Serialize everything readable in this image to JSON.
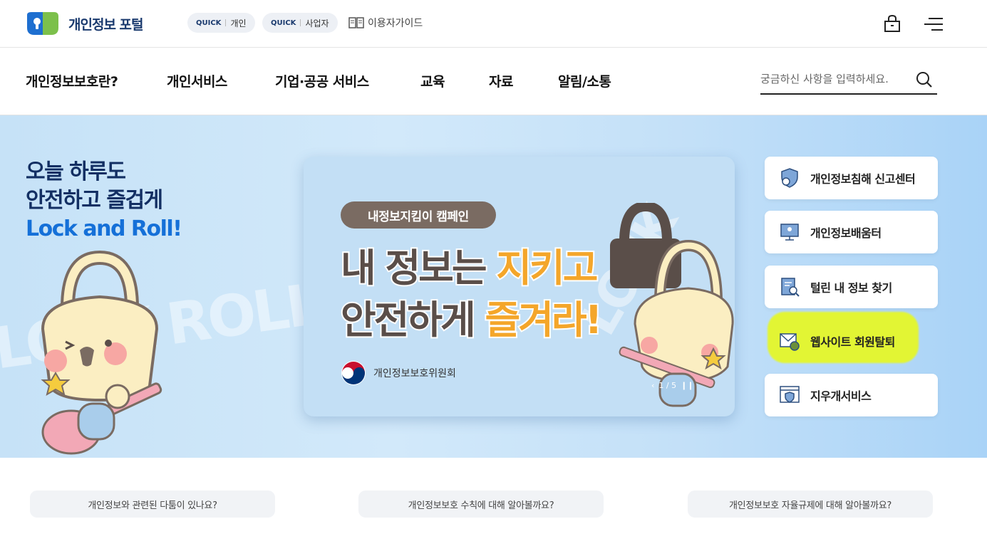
{
  "header": {
    "logo_text": "개인정보 포털",
    "quick_personal": {
      "tag": "QUICK",
      "label": "개인"
    },
    "quick_business": {
      "tag": "QUICK",
      "label": "사업자"
    },
    "guide_label": "이용자가이드",
    "icons": [
      "lock-icon",
      "menu-icon"
    ]
  },
  "nav": {
    "items": [
      "개인정보보호란?",
      "개인서비스",
      "기업·공공 서비스",
      "교육",
      "자료",
      "알림/소통"
    ],
    "search_placeholder": "궁금하신 사항을 입력하세요."
  },
  "hero": {
    "line1": "오늘 하루도",
    "line2": "안전하고 즐겁게",
    "line3": "Lock and Roll!",
    "banner": {
      "campaign": "내정보지킴이 캠페인",
      "line1_a": "내 정보는 ",
      "line1_b": "지키고",
      "line2_a": "안전하게 ",
      "line2_b": "즐겨라!",
      "org": "개인정보보호위원회",
      "pager": "1 / 5"
    },
    "quick_links": [
      {
        "label": "개인정보침해 신고센터",
        "icon": "shield-person-icon"
      },
      {
        "label": "개인정보배움터",
        "icon": "monitor-person-icon"
      },
      {
        "label": "털린 내 정보 찾기",
        "icon": "document-search-icon"
      },
      {
        "label": "웹사이트 회원탈퇴",
        "icon": "mail-lock-icon"
      },
      {
        "label": "지우개서비스",
        "icon": "browser-shield-icon"
      }
    ]
  },
  "faq": [
    "개인정보와 관련된 다툼이 있나요?",
    "개인정보보호 수칙에 대해 알아볼까요?",
    "개인정보보호 자율규제에 대해 알아볼까요?"
  ],
  "colors": {
    "brand_navy": "#132f63",
    "brand_blue": "#1570d8",
    "highlight": "#e5f72a"
  }
}
